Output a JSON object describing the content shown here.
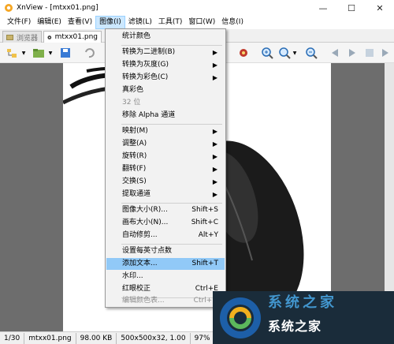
{
  "window": {
    "title": "XnView - [mtxx01.png]"
  },
  "controls": {
    "minimize": "—",
    "maximize": "☐",
    "close": "✕"
  },
  "menubar": [
    {
      "label": "文件(F)"
    },
    {
      "label": "编辑(E)"
    },
    {
      "label": "查看(V)"
    },
    {
      "label": "图像(I)",
      "active": true
    },
    {
      "label": "滤镜(L)"
    },
    {
      "label": "工具(T)"
    },
    {
      "label": "窗口(W)"
    },
    {
      "label": "信息(I)"
    }
  ],
  "tabs": [
    {
      "label": "浏览器"
    },
    {
      "label": "mtxx01.png"
    }
  ],
  "image_menu": {
    "items": [
      {
        "label": "统计颜色"
      },
      {
        "label": "转换为二进制(B)",
        "submenu": true
      },
      {
        "label": "转换为灰度(G)",
        "submenu": true
      },
      {
        "label": "转换为彩色(C)",
        "submenu": true
      },
      {
        "label": "真彩色"
      },
      {
        "label": "32 位",
        "disabled": true
      },
      {
        "label": "移除 Alpha 通道"
      },
      {
        "label": "映射(M)",
        "submenu": true
      },
      {
        "label": "调整(A)",
        "submenu": true
      },
      {
        "label": "旋转(R)",
        "submenu": true
      },
      {
        "label": "翻转(F)",
        "submenu": true
      },
      {
        "label": "交换(S)",
        "submenu": true
      },
      {
        "label": "提取通道",
        "submenu": true
      },
      {
        "label": "图像大小(R)...",
        "shortcut": "Shift+S"
      },
      {
        "label": "画布大小(N)...",
        "shortcut": "Shift+C"
      },
      {
        "label": "自动修剪...",
        "shortcut": "Alt+Y"
      },
      {
        "label": "设置每英寸点数"
      },
      {
        "label": "添加文本...",
        "shortcut": "Shift+T",
        "highlighted": true
      },
      {
        "label": "水印..."
      },
      {
        "label": "红眼校正",
        "shortcut": "Ctrl+E"
      },
      {
        "label": "编辑颜色表...",
        "shortcut": "Ctrl+M",
        "disabled": true
      }
    ]
  },
  "statusbar": [
    {
      "text": "1/30"
    },
    {
      "text": "mtxx01.png"
    },
    {
      "text": "98.00 KB"
    },
    {
      "text": "500x500x32, 1.00"
    },
    {
      "text": "97%"
    }
  ],
  "watermark": {
    "text": "系统之家",
    "top_text": "系统之家"
  },
  "colors": {
    "highlight": "#91c9f7",
    "menu_bg": "#f2f2f2",
    "viewer_bg": "#6d6d6d"
  }
}
